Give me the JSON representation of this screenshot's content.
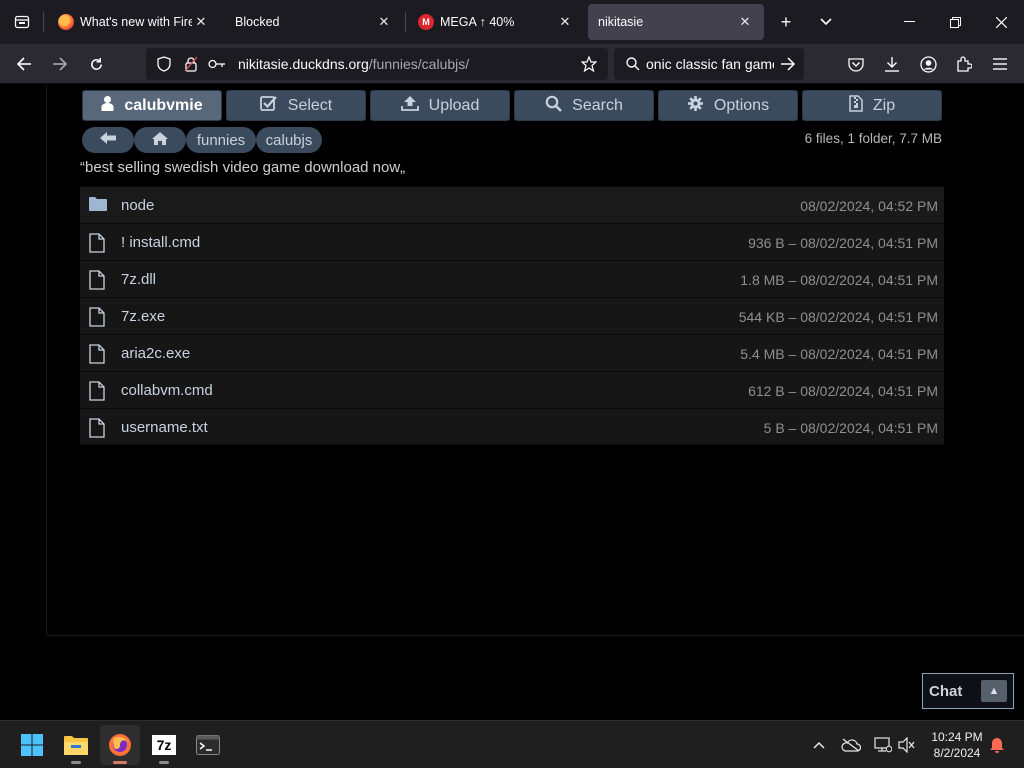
{
  "browser": {
    "tabs": [
      {
        "title": "What's new with Firefox",
        "favicon": "firefox-icon",
        "close": "✕"
      },
      {
        "title": "Blocked",
        "favicon": "",
        "close": "✕"
      },
      {
        "title": "MEGA ↑ 40%",
        "favicon": "mega-icon",
        "close": "✕"
      },
      {
        "title": "nikitasie",
        "favicon": "",
        "close": "✕",
        "active": true
      }
    ],
    "new_tab_label": "+",
    "url_host": "nikitasie.duckdns.org",
    "url_path": "/funnies/calubjs/",
    "search_text": "onic classic fan game"
  },
  "toolbar": {
    "user_label": "calubvmie",
    "select_label": "Select",
    "upload_label": "Upload",
    "search_label": "Search",
    "options_label": "Options",
    "zip_label": "Zip"
  },
  "breadcrumb": {
    "items": [
      "funnies",
      "calubjs"
    ]
  },
  "summary": "6 files, 1 folder, 7.7 MB",
  "quote": "“best selling swedish video game download now„",
  "files": [
    {
      "name": "node",
      "meta": "08/02/2024, 04:52 PM",
      "type": "folder"
    },
    {
      "name": "! install.cmd",
      "meta": "936 B – 08/02/2024, 04:51 PM",
      "type": "file"
    },
    {
      "name": "7z.dll",
      "meta": "1.8 MB – 08/02/2024, 04:51 PM",
      "type": "file"
    },
    {
      "name": "7z.exe",
      "meta": "544 KB – 08/02/2024, 04:51 PM",
      "type": "file"
    },
    {
      "name": "aria2c.exe",
      "meta": "5.4 MB – 08/02/2024, 04:51 PM",
      "type": "file"
    },
    {
      "name": "collabvm.cmd",
      "meta": "612 B – 08/02/2024, 04:51 PM",
      "type": "file"
    },
    {
      "name": "username.txt",
      "meta": "5 B – 08/02/2024, 04:51 PM",
      "type": "file"
    }
  ],
  "chat": {
    "label": "Chat",
    "arrow": "▲"
  },
  "taskbar": {
    "apps": [
      "windows-start-icon",
      "file-explorer-icon",
      "firefox-icon",
      "7zip-icon",
      "terminal-icon"
    ],
    "sevenzip_label": "7z",
    "time": "10:24 PM",
    "date": "8/2/2024"
  },
  "colors": {
    "accent_button": "#3b4a5c",
    "active_user_button": "#58677a",
    "link_text": "#c8d2e0",
    "browser_bg": "#1c1b22"
  }
}
